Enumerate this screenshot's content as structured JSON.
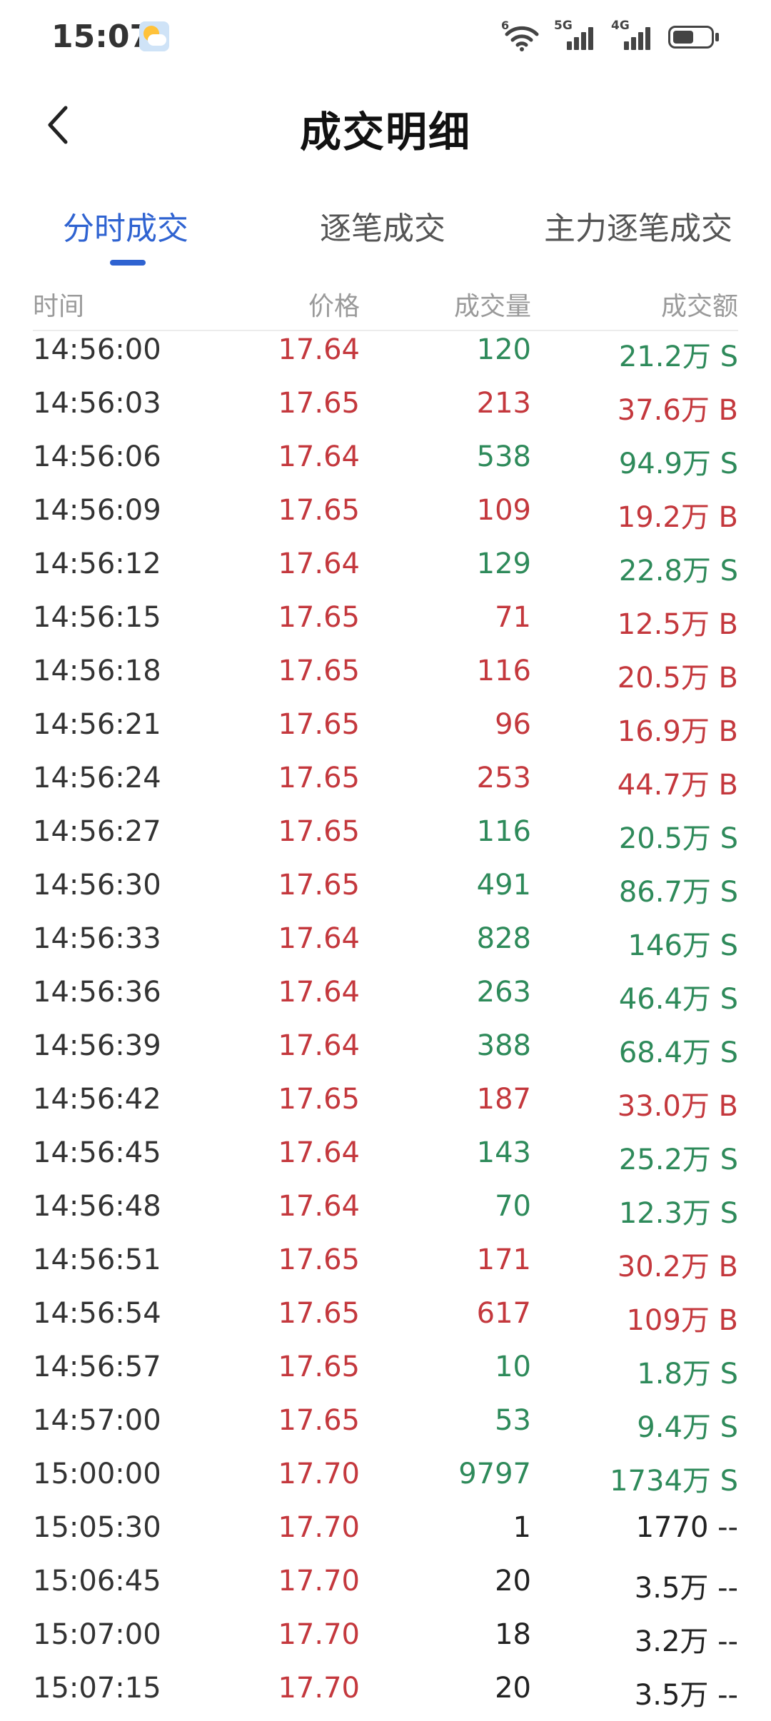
{
  "status_bar": {
    "time": "15:07",
    "wifi_label": "6",
    "sim1_label": "5G",
    "sim2_label": "4G",
    "battery_level": 0.55
  },
  "header": {
    "title": "成交明细"
  },
  "tabs": [
    {
      "label": "分时成交",
      "active": true
    },
    {
      "label": "逐笔成交",
      "active": false
    },
    {
      "label": "主力逐笔成交",
      "active": false
    }
  ],
  "columns": {
    "time": "时间",
    "price": "价格",
    "volume": "成交量",
    "amount": "成交额"
  },
  "colors": {
    "up": "#c4383d",
    "down": "#2e8a5a",
    "accent": "#2f63d1"
  },
  "rows": [
    {
      "time": "14:56:00",
      "price": "17.64",
      "volume": "120",
      "amount": "21.2万 S",
      "dir": "S"
    },
    {
      "time": "14:56:03",
      "price": "17.65",
      "volume": "213",
      "amount": "37.6万 B",
      "dir": "B"
    },
    {
      "time": "14:56:06",
      "price": "17.64",
      "volume": "538",
      "amount": "94.9万 S",
      "dir": "S"
    },
    {
      "time": "14:56:09",
      "price": "17.65",
      "volume": "109",
      "amount": "19.2万 B",
      "dir": "B"
    },
    {
      "time": "14:56:12",
      "price": "17.64",
      "volume": "129",
      "amount": "22.8万 S",
      "dir": "S"
    },
    {
      "time": "14:56:15",
      "price": "17.65",
      "volume": "71",
      "amount": "12.5万 B",
      "dir": "B"
    },
    {
      "time": "14:56:18",
      "price": "17.65",
      "volume": "116",
      "amount": "20.5万 B",
      "dir": "B"
    },
    {
      "time": "14:56:21",
      "price": "17.65",
      "volume": "96",
      "amount": "16.9万 B",
      "dir": "B"
    },
    {
      "time": "14:56:24",
      "price": "17.65",
      "volume": "253",
      "amount": "44.7万 B",
      "dir": "B"
    },
    {
      "time": "14:56:27",
      "price": "17.65",
      "volume": "116",
      "amount": "20.5万 S",
      "dir": "S"
    },
    {
      "time": "14:56:30",
      "price": "17.65",
      "volume": "491",
      "amount": "86.7万 S",
      "dir": "S"
    },
    {
      "time": "14:56:33",
      "price": "17.64",
      "volume": "828",
      "amount": "146万 S",
      "dir": "S"
    },
    {
      "time": "14:56:36",
      "price": "17.64",
      "volume": "263",
      "amount": "46.4万 S",
      "dir": "S"
    },
    {
      "time": "14:56:39",
      "price": "17.64",
      "volume": "388",
      "amount": "68.4万 S",
      "dir": "S"
    },
    {
      "time": "14:56:42",
      "price": "17.65",
      "volume": "187",
      "amount": "33.0万 B",
      "dir": "B"
    },
    {
      "time": "14:56:45",
      "price": "17.64",
      "volume": "143",
      "amount": "25.2万 S",
      "dir": "S"
    },
    {
      "time": "14:56:48",
      "price": "17.64",
      "volume": "70",
      "amount": "12.3万 S",
      "dir": "S"
    },
    {
      "time": "14:56:51",
      "price": "17.65",
      "volume": "171",
      "amount": "30.2万 B",
      "dir": "B"
    },
    {
      "time": "14:56:54",
      "price": "17.65",
      "volume": "617",
      "amount": "109万 B",
      "dir": "B"
    },
    {
      "time": "14:56:57",
      "price": "17.65",
      "volume": "10",
      "amount": "1.8万 S",
      "dir": "S"
    },
    {
      "time": "14:57:00",
      "price": "17.65",
      "volume": "53",
      "amount": "9.4万 S",
      "dir": "S"
    },
    {
      "time": "15:00:00",
      "price": "17.70",
      "volume": "9797",
      "amount": "1734万 S",
      "dir": "S"
    },
    {
      "time": "15:05:30",
      "price": "17.70",
      "volume": "1",
      "amount": "1770 --",
      "dir": "-"
    },
    {
      "time": "15:06:45",
      "price": "17.70",
      "volume": "20",
      "amount": "3.5万 --",
      "dir": "-"
    },
    {
      "time": "15:07:00",
      "price": "17.70",
      "volume": "18",
      "amount": "3.2万 --",
      "dir": "-"
    },
    {
      "time": "15:07:15",
      "price": "17.70",
      "volume": "20",
      "amount": "3.5万 --",
      "dir": "-"
    }
  ]
}
